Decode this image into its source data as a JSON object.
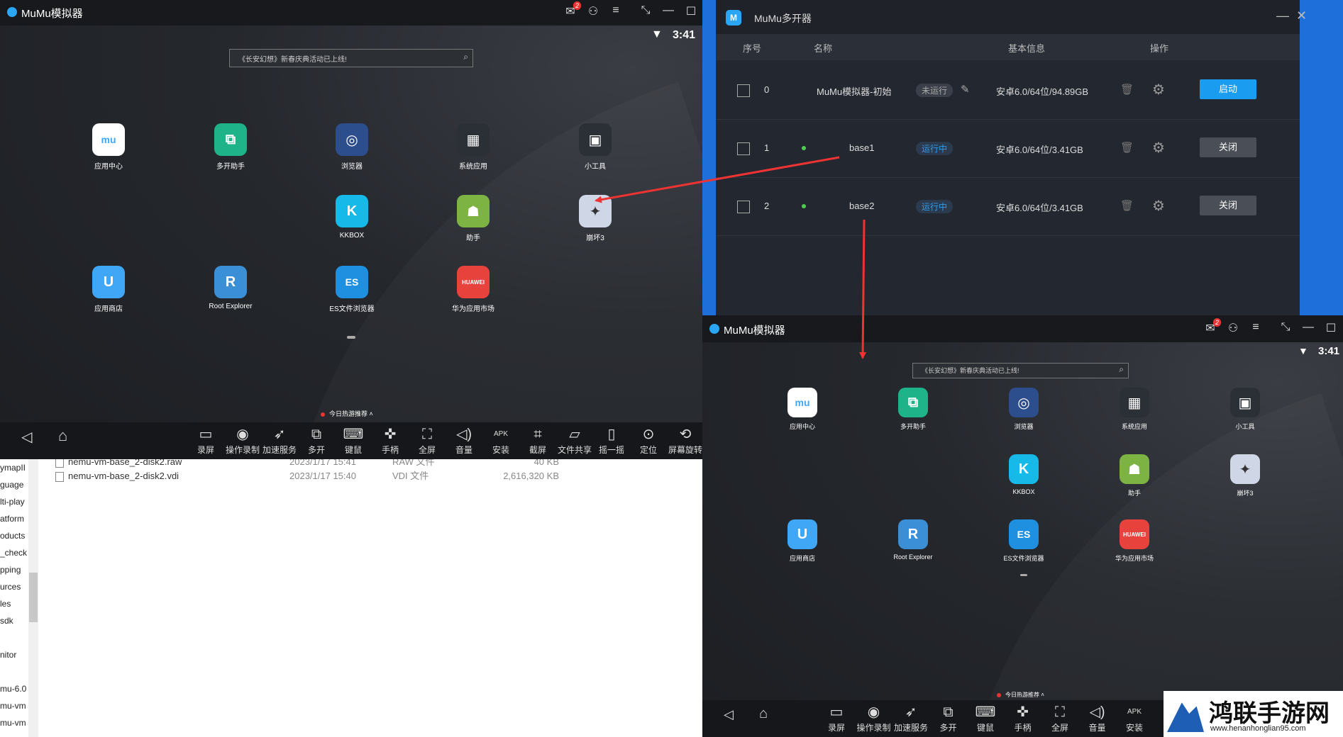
{
  "emu1": {
    "title": "MuMu模拟器",
    "badge": "2",
    "clock": "3:41",
    "search_text": "《长安幻想》新春庆典活动已上线!",
    "apps": [
      {
        "label": "应用中心",
        "icon": "app-center-icon",
        "color": "#ffffff",
        "glyph": "mu"
      },
      {
        "label": "多开助手",
        "icon": "multi-open-icon",
        "color": "#1fb38a",
        "glyph": "⧉"
      },
      {
        "label": "浏览器",
        "icon": "compass-icon",
        "color": "#2d4e8c",
        "glyph": "◎"
      },
      {
        "label": "系统应用",
        "icon": "system-apps-icon",
        "color": "#2b2f36",
        "glyph": "▦"
      },
      {
        "label": "小工具",
        "icon": "tools-icon",
        "color": "#2b2f36",
        "glyph": "▣"
      },
      {
        "label": "KKBOX",
        "icon": "kkbox-icon",
        "color": "#16b9e8",
        "glyph": "K"
      },
      {
        "label": "助手",
        "icon": "android-icon",
        "color": "#7cb342",
        "glyph": "☗"
      },
      {
        "label": "崩坏3",
        "icon": "honkai-icon",
        "color": "#cfd6e6",
        "glyph": "✦"
      },
      {
        "label": "应用商店",
        "icon": "app-store-icon",
        "color": "#3fa7f5",
        "glyph": "U"
      },
      {
        "label": "Root Explorer",
        "icon": "root-explorer-icon",
        "color": "#3b8fd6",
        "glyph": "R"
      },
      {
        "label": "ES文件浏览器",
        "icon": "es-explorer-icon",
        "color": "#1f8fe0",
        "glyph": "ES"
      },
      {
        "label": "华为应用市场",
        "icon": "huawei-icon",
        "color": "#e8423c",
        "glyph": "HUAWEI"
      }
    ],
    "recommend": "今日热游推荐",
    "tools": [
      {
        "label": "录屏",
        "icon": "record-icon",
        "glyph": "▭"
      },
      {
        "label": "操作录制",
        "icon": "macro-record-icon",
        "glyph": "◉"
      },
      {
        "label": "加速服务",
        "icon": "rocket-icon",
        "glyph": "➶"
      },
      {
        "label": "多开",
        "icon": "multi-icon",
        "glyph": "⧉"
      },
      {
        "label": "键鼠",
        "icon": "keyboard-icon",
        "glyph": "⌨"
      },
      {
        "label": "手柄",
        "icon": "gamepad-icon",
        "glyph": "✜"
      },
      {
        "label": "全屏",
        "icon": "fullscreen-icon",
        "glyph": "⛶"
      },
      {
        "label": "音量",
        "icon": "volume-icon",
        "glyph": "◁)"
      },
      {
        "label": "安装",
        "icon": "apk-icon",
        "glyph": "APK"
      },
      {
        "label": "截屏",
        "icon": "crop-icon",
        "glyph": "⌗"
      },
      {
        "label": "文件共享",
        "icon": "folder-icon",
        "glyph": "▱"
      },
      {
        "label": "摇一摇",
        "icon": "shake-icon",
        "glyph": "▯"
      },
      {
        "label": "定位",
        "icon": "location-icon",
        "glyph": "⊙"
      },
      {
        "label": "屏幕旋转",
        "icon": "rotate-icon",
        "glyph": "⟲"
      }
    ]
  },
  "files": {
    "tree": [
      "ymapII",
      "guage",
      "lti-play",
      "atform",
      "oducts",
      "_check",
      "pping",
      "urces",
      "les",
      "sdk",
      "",
      "nitor",
      "",
      "mu-6.0",
      "mu-vm",
      "mu-vm"
    ],
    "rows": [
      {
        "name": "nemu-vm-base_2-disk2.raw",
        "date": "2023/1/17 15:41",
        "type": "RAW 文件",
        "size": "40 KB"
      },
      {
        "name": "nemu-vm-base_2-disk2.vdi",
        "date": "2023/1/17 15:40",
        "type": "VDI 文件",
        "size": "2,616,320 KB"
      }
    ]
  },
  "multi": {
    "title": "MuMu多开器",
    "headers": {
      "idx": "序号",
      "name": "名称",
      "info": "基本信息",
      "ops": "操作"
    },
    "rows": [
      {
        "idx": "0",
        "name": "MuMu模拟器-初始",
        "status": "未运行",
        "info": "安卓6.0/64位/94.89GB",
        "button": "启动",
        "running": false
      },
      {
        "idx": "1",
        "name": "base1",
        "status": "运行中",
        "info": "安卓6.0/64位/3.41GB",
        "button": "关闭",
        "running": true
      },
      {
        "idx": "2",
        "name": "base2",
        "status": "运行中",
        "info": "安卓6.0/64位/3.41GB",
        "button": "关闭",
        "running": true
      }
    ]
  },
  "emu2": {
    "title": "MuMu模拟器",
    "badge": "2",
    "clock": "3:41",
    "search_text": "《长安幻想》新春庆典活动已上线!",
    "recommend": "今日热游推荐",
    "tools": [
      {
        "label": "录屏",
        "icon": "record-icon",
        "glyph": "▭"
      },
      {
        "label": "操作录制",
        "icon": "macro-record-icon",
        "glyph": "◉"
      },
      {
        "label": "加速服务",
        "icon": "rocket-icon",
        "glyph": "➶"
      },
      {
        "label": "多开",
        "icon": "multi-icon",
        "glyph": "⧉"
      },
      {
        "label": "键鼠",
        "icon": "keyboard-icon",
        "glyph": "⌨"
      },
      {
        "label": "手柄",
        "icon": "gamepad-icon",
        "glyph": "✜"
      },
      {
        "label": "全屏",
        "icon": "fullscreen-icon",
        "glyph": "⛶"
      },
      {
        "label": "音量",
        "icon": "volume-icon",
        "glyph": "◁)"
      },
      {
        "label": "安装",
        "icon": "apk-icon",
        "glyph": "APK"
      }
    ]
  },
  "watermark": {
    "title": "鸿联手游网",
    "url": "www.henanhonglian95.com"
  }
}
